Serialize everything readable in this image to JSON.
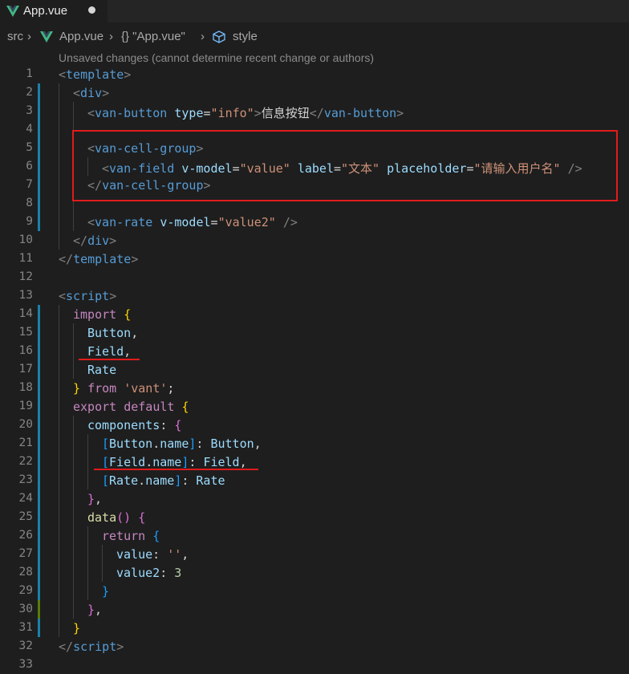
{
  "tab": {
    "title": "App.vue",
    "icon": "vue-icon",
    "dirty": true
  },
  "breadcrumb": {
    "segments": [
      "src",
      "App.vue",
      "{} \"App.vue\"",
      "style"
    ],
    "separator": "›"
  },
  "blame_hint": "Unsaved changes (cannot determine recent change or authors)",
  "line_numbers": [
    "1",
    "2",
    "3",
    "4",
    "5",
    "6",
    "7",
    "8",
    "9",
    "10",
    "11",
    "12",
    "13",
    "14",
    "15",
    "16",
    "17",
    "18",
    "19",
    "20",
    "21",
    "22",
    "23",
    "24",
    "25",
    "26",
    "27",
    "28",
    "29",
    "30",
    "31",
    "32",
    "33"
  ],
  "code": {
    "l3_text": "信息按钮",
    "l6_label": "\"文本\"",
    "l6_placeholder": "\"请输入用户名\"",
    "l6_vmodel": "\"value\"",
    "l9_vmodel": "\"value2\"",
    "l3_type": "\"info\"",
    "l18_from": "'vant'",
    "l27_value": "''",
    "l28_value": "3"
  },
  "colors": {
    "background": "#1e1e1e",
    "highlight_box": "#e01b1b",
    "gutter_modified": "#1b81a8",
    "gutter_added": "#587c0c"
  }
}
